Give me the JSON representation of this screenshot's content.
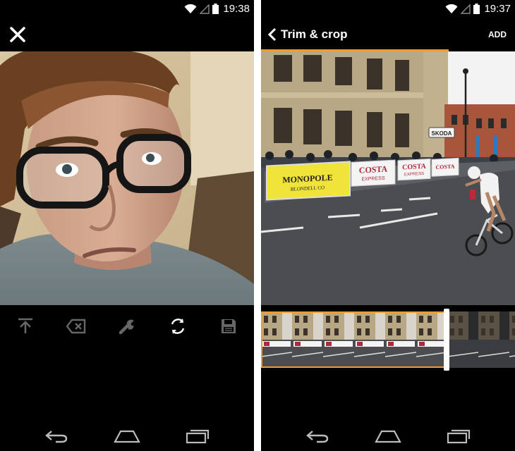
{
  "left_screen": {
    "status": {
      "time": "19:38"
    },
    "close_icon": "close-icon",
    "toolbar": [
      "share-icon",
      "delete-icon",
      "wrench-icon",
      "rotate-icon",
      "save-icon"
    ]
  },
  "right_screen": {
    "status": {
      "time": "19:37"
    },
    "header": {
      "title": "Trim & crop",
      "add_label": "ADD"
    },
    "trim_progress": 0.74,
    "video_signs": {
      "banner_1_line1": "MONOPOLE",
      "banner_1_line2": "BLONDELL CO",
      "banner_2_line1": "COSTA",
      "banner_2_line2": "EXPRESS",
      "banner_3_line1": "COSTA",
      "banner_3_line2": "EXPRESS",
      "banner_4": "COSTA",
      "sign_skoda": "SKODA"
    }
  },
  "nav": [
    "back-icon",
    "home-icon",
    "recents-icon"
  ],
  "colors": {
    "accent": "#f39a2e",
    "background": "#000000",
    "foreground": "#ffffff"
  }
}
